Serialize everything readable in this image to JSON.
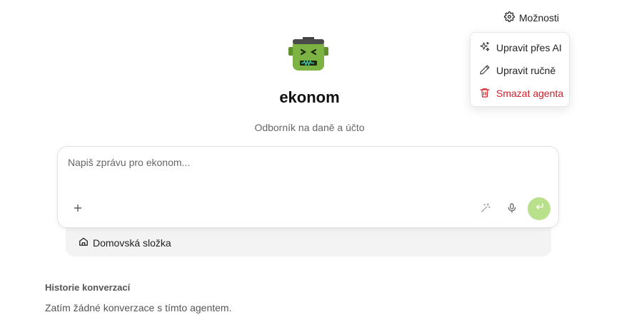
{
  "header": {
    "options_label": "Možnosti"
  },
  "menu": {
    "items": [
      {
        "label": "Upravit přes AI",
        "icon": "sparkles-icon"
      },
      {
        "label": "Upravit ručně",
        "icon": "pencil-icon"
      },
      {
        "label": "Smazat agenta",
        "icon": "trash-icon"
      }
    ],
    "danger_color": "#d0202a"
  },
  "agent": {
    "name": "ekonom",
    "description": "Odborník na daně a účto",
    "avatar": "frankenstein-robot-avatar",
    "avatar_color": "#7cb342"
  },
  "composer": {
    "placeholder": "Napiš zprávu pro ekonom...",
    "value": "",
    "send_color": "#b9e08a"
  },
  "folder": {
    "label": "Domovská složka"
  },
  "history": {
    "title": "Historie konverzací",
    "empty_text": "Zatím žádné konverzace s tímto agentem."
  }
}
